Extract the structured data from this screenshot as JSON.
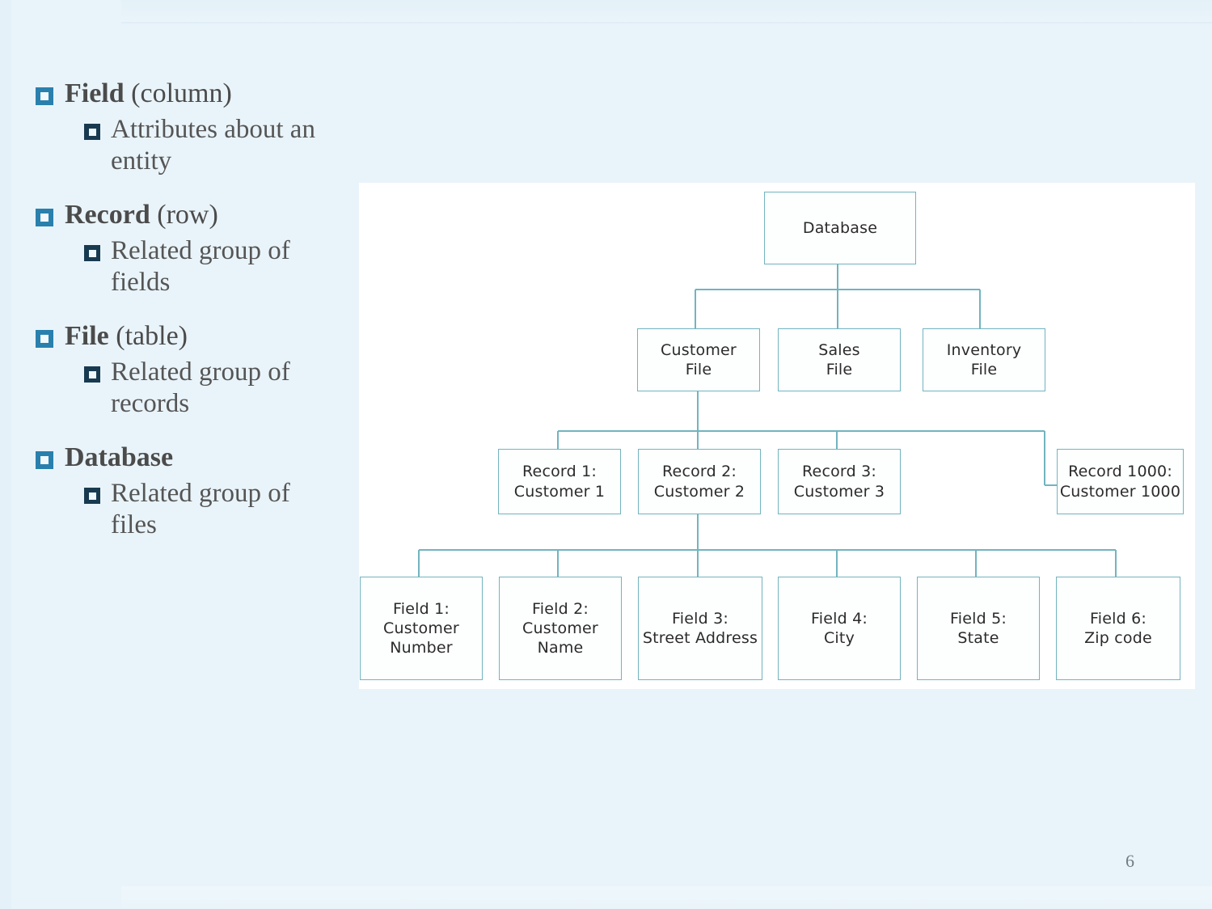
{
  "slide": {
    "page_number": "6",
    "accent_level1": "#2980ad",
    "accent_level2": "#183a50",
    "diagram_border": "#72b4bf",
    "background": "#e9f4fa",
    "panel_background": "#ffffff"
  },
  "bullets": [
    {
      "level": 1,
      "bold": "Field",
      "rest": " (column)"
    },
    {
      "level": 2,
      "text": "Attributes about an entity"
    },
    {
      "level": 1,
      "bold": "Record",
      "rest": " (row)"
    },
    {
      "level": 2,
      "text": "Related group of fields"
    },
    {
      "level": 1,
      "bold": "File",
      "rest": " (table)"
    },
    {
      "level": 2,
      "text": "Related group of records"
    },
    {
      "level": 1,
      "bold": "Database",
      "rest": ""
    },
    {
      "level": 2,
      "text": "Related group of files"
    }
  ],
  "diagram": {
    "root": {
      "label": "Database"
    },
    "files": [
      {
        "label": "Customer\nFile",
        "line1": "Customer",
        "line2": "File"
      },
      {
        "label": "Sales\nFile",
        "line1": "Sales",
        "line2": "File"
      },
      {
        "label": "Inventory\nFile",
        "line1": "Inventory",
        "line2": "File"
      }
    ],
    "records": [
      {
        "line1": "Record 1:",
        "line2": "Customer 1"
      },
      {
        "line1": "Record 2:",
        "line2": "Customer 2"
      },
      {
        "line1": "Record 3:",
        "line2": "Customer 3"
      },
      {
        "line1": "Record 1000:",
        "line2": "Customer 1000"
      }
    ],
    "fields": [
      {
        "line1": "Field 1:",
        "line2": "Customer",
        "line3": "Number"
      },
      {
        "line1": "Field 2:",
        "line2": "Customer",
        "line3": "Name"
      },
      {
        "line1": "Field 3:",
        "line2": "Street Address",
        "line3": ""
      },
      {
        "line1": "Field 4:",
        "line2": "City",
        "line3": ""
      },
      {
        "line1": "Field 5:",
        "line2": "State",
        "line3": ""
      },
      {
        "line1": "Field 6:",
        "line2": "Zip code",
        "line3": ""
      }
    ]
  }
}
